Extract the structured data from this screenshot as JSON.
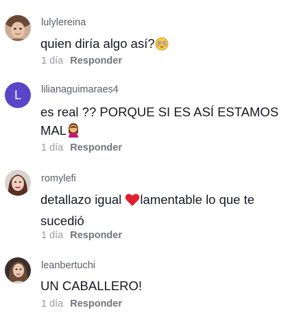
{
  "comments": [
    {
      "username": "lulylereina",
      "text": "quien diría algo así?",
      "emoji": "flushed-face-emoji",
      "time": "1 día",
      "reply_label": "Responder"
    },
    {
      "username": "lilianaguimaraes4",
      "avatar_initial": "L",
      "text": "es real ?? PORQUE SI ES ASÍ ESTAMOS MAL",
      "emoji": "woman-facepalming-emoji",
      "time": "1 día",
      "reply_label": "Responder"
    },
    {
      "username": "romylefi",
      "text_before": "detallazo igual ",
      "emoji": "red-heart-emoji",
      "text_after": "lamentable lo que te sucedió",
      "time": "1 día",
      "reply_label": "Responder"
    },
    {
      "username": "leanbertuchi",
      "text": "UN CABALLERO!",
      "time": "1 día",
      "reply_label": "Responder"
    }
  ],
  "colors": {
    "username": "#5b5e66",
    "text": "#161823",
    "time": "#9a9ba1",
    "reply": "#73757c",
    "avatar_initial_bg": "#5a45c9"
  }
}
